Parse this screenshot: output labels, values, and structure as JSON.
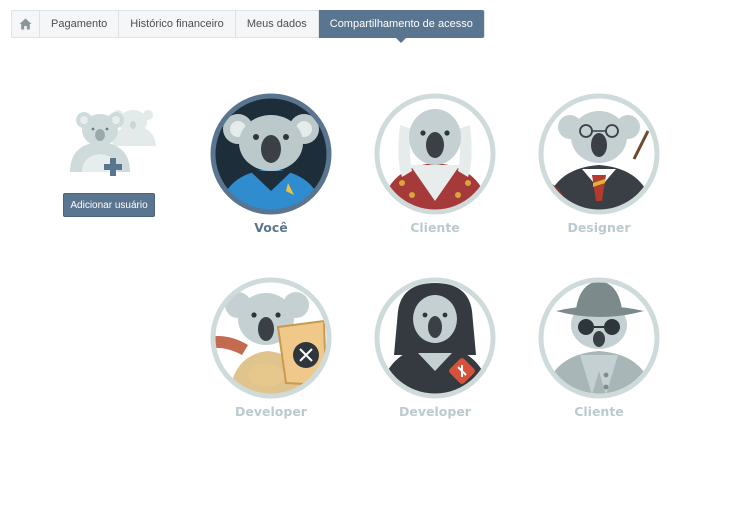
{
  "nav": {
    "home_icon": "home-icon",
    "tabs": [
      {
        "label": "Pagamento"
      },
      {
        "label": "Histórico financeiro"
      },
      {
        "label": "Meus dados"
      },
      {
        "label": "Compartilhamento de acesso"
      }
    ],
    "active_tab": "Compartilhamento de acesso"
  },
  "add_user": {
    "icon": "add-koala-users-icon",
    "button_label": "Adicionar usuário"
  },
  "users": [
    {
      "name": "Você",
      "avatar": "koala-starfleet-avatar"
    },
    {
      "name": "Cliente",
      "avatar": "koala-royal-avatar"
    },
    {
      "name": "Designer",
      "avatar": "koala-wizard-avatar"
    },
    {
      "name": "Developer",
      "avatar": "koala-scroll-avatar"
    },
    {
      "name": "Developer",
      "avatar": "koala-hoodie-avatar"
    },
    {
      "name": "Cliente",
      "avatar": "koala-spy-avatar"
    }
  ],
  "colors": {
    "accent": "#5a7590",
    "ring": "#cfdadb",
    "muted_name": "#bccacf"
  }
}
